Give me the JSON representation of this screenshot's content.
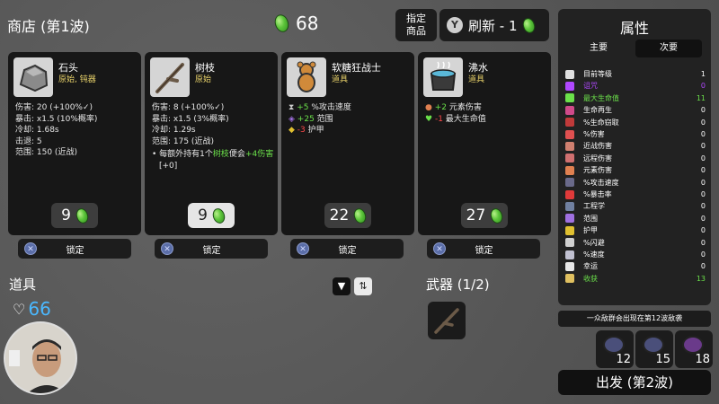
{
  "shop": {
    "title": "商店 (第1波)",
    "gold": "68"
  },
  "buttons": {
    "lock_shop": "指定\n商品",
    "reroll": "刷新 - 1",
    "reroll_key": "Y",
    "go": "出发 (第2波)"
  },
  "cards": [
    {
      "name": "石头",
      "sub": "原始, 钝器",
      "price": "9",
      "selected": false,
      "lines": [
        "伤害: 20 (+100%✓)",
        "暴击: x1.5 (10%概率)",
        "冷却: 1.68s",
        "击退: 5",
        "范围: 150 (近战)"
      ],
      "lock": "锁定"
    },
    {
      "name": "树枝",
      "sub": "原始",
      "price": "9",
      "selected": true,
      "lines": [
        "伤害: 8 (+100%✓)",
        "暴击: x1.5 (3%概率)",
        "冷却: 1.29s",
        "范围: 175 (近战)"
      ],
      "bullet_pre": "每额外持有1个",
      "bullet_item": "树枝",
      "bullet_mid": "便会",
      "bullet_gain": "+4伤害",
      "bullet_post": " [+0]",
      "lock": "锁定"
    },
    {
      "name": "软糖狂战士",
      "sub": "道具",
      "price": "22",
      "selected": false,
      "effects": [
        {
          "icon": "hourglass-icon",
          "val": "+5",
          "text": " %攻击速度",
          "cls": "green"
        },
        {
          "icon": "range-icon",
          "val": "+25",
          "text": " 范围",
          "cls": "green"
        },
        {
          "icon": "shield-icon",
          "val": "-3",
          "text": " 护甲",
          "cls": "red"
        }
      ],
      "lock": "锁定"
    },
    {
      "name": "沸水",
      "sub": "道具",
      "price": "27",
      "selected": false,
      "effects": [
        {
          "icon": "fire-icon",
          "val": "+2",
          "text": " 元素伤害",
          "cls": "green"
        },
        {
          "icon": "heart-icon",
          "val": "-1",
          "text": " 最大生命值",
          "cls": "red"
        }
      ],
      "lock": "锁定"
    }
  ],
  "lower": {
    "items_label": "道具",
    "weapons_label": "武器 (1/2)",
    "hp": "66"
  },
  "stats_panel": {
    "title": "属性",
    "tab_primary": "主要",
    "tab_secondary": "次要",
    "rows": [
      {
        "name": "目前等级",
        "value": "1",
        "color": "#e0e0e0",
        "style": ""
      },
      {
        "name": "诅咒",
        "value": "0",
        "color": "#b048ff",
        "style": "purple"
      },
      {
        "name": "最大生命值",
        "value": "11",
        "color": "#6be04a",
        "style": "green"
      },
      {
        "name": "生命再生",
        "value": "0",
        "color": "#d04a8a",
        "style": ""
      },
      {
        "name": "%生命窃取",
        "value": "0",
        "color": "#c03a3a",
        "style": ""
      },
      {
        "name": "%伤害",
        "value": "0",
        "color": "#e05050",
        "style": ""
      },
      {
        "name": "近战伤害",
        "value": "0",
        "color": "#d08070",
        "style": ""
      },
      {
        "name": "远程伤害",
        "value": "0",
        "color": "#d07070",
        "style": ""
      },
      {
        "name": "元素伤害",
        "value": "0",
        "color": "#e08050",
        "style": ""
      },
      {
        "name": "%攻击速度",
        "value": "0",
        "color": "#6a6a8a",
        "style": ""
      },
      {
        "name": "%暴击率",
        "value": "0",
        "color": "#e03a3a",
        "style": ""
      },
      {
        "name": "工程学",
        "value": "0",
        "color": "#7080a0",
        "style": ""
      },
      {
        "name": "范围",
        "value": "0",
        "color": "#a070e0",
        "style": ""
      },
      {
        "name": "护甲",
        "value": "0",
        "color": "#e0c030",
        "style": ""
      },
      {
        "name": "%闪避",
        "value": "0",
        "color": "#d0d0d0",
        "style": ""
      },
      {
        "name": "%速度",
        "value": "0",
        "color": "#c0c0d0",
        "style": ""
      },
      {
        "name": "幸运",
        "value": "0",
        "color": "#e8e8e8",
        "style": ""
      },
      {
        "name": "收获",
        "value": "13",
        "color": "#e0c060",
        "style": "green"
      }
    ]
  },
  "wave_note": "一众敌群会出现在第12波敌袭",
  "enemies": [
    "12",
    "15",
    "18"
  ]
}
